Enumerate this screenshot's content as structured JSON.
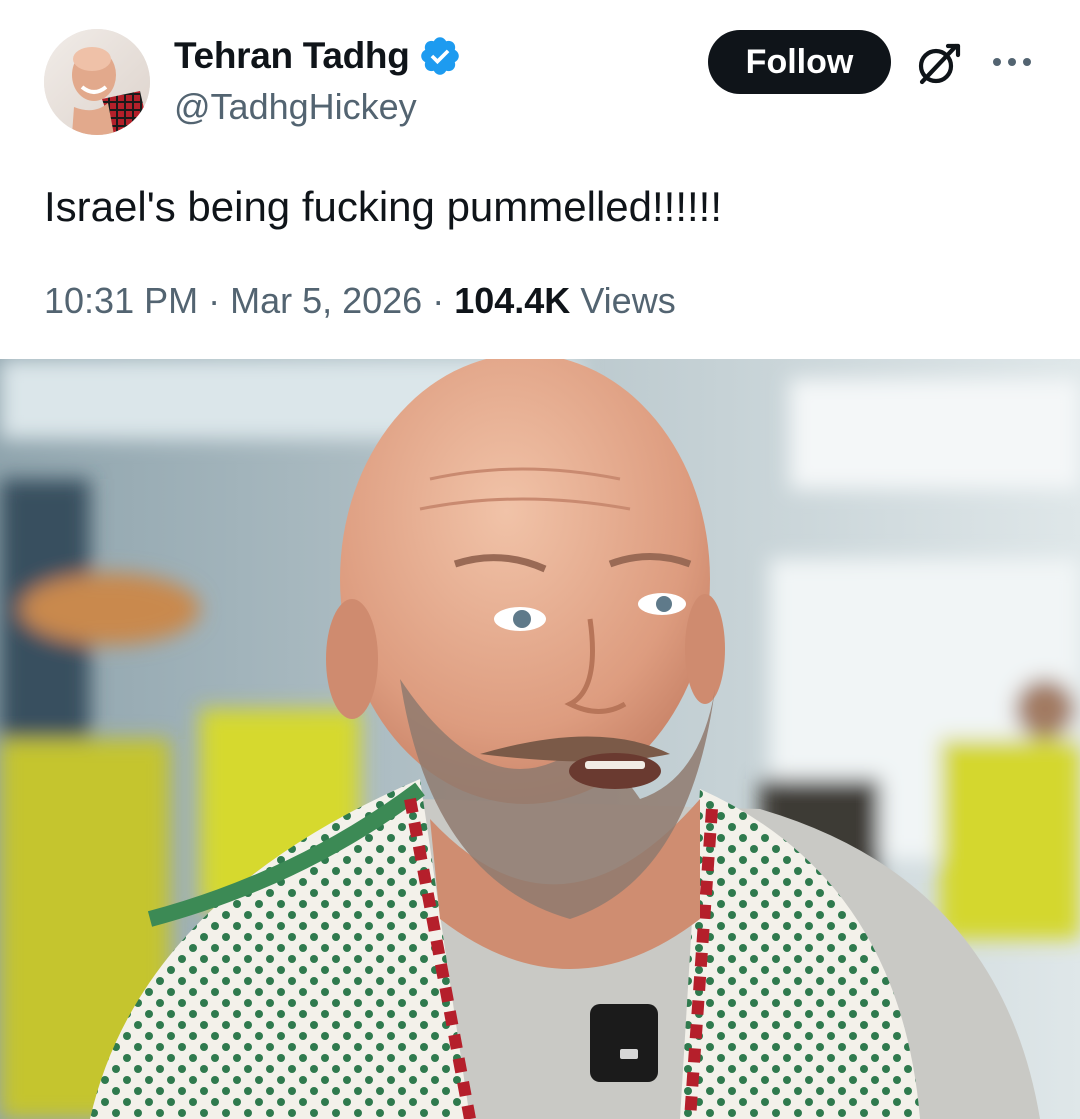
{
  "tweet": {
    "author": {
      "display_name": "Tehran Tadhg",
      "handle": "@TadhgHickey",
      "verified": true,
      "avatar_icon": "profile-photo"
    },
    "actions": {
      "follow_label": "Follow",
      "grok_icon": "grok-icon",
      "more_icon": "more-icon"
    },
    "text": "Israel's being fucking pummelled!!!!!!",
    "meta": {
      "time": "10:31 PM",
      "separator": "·",
      "date": "Mar 5, 2026",
      "views_count": "104.4K",
      "views_label": "Views"
    },
    "media": {
      "type": "photo",
      "alt_icon": "attached-photo"
    }
  },
  "colors": {
    "text_primary": "#0f1419",
    "text_secondary": "#536471",
    "follow_bg": "#0f1419",
    "verified_blue": "#1d9bf0"
  }
}
